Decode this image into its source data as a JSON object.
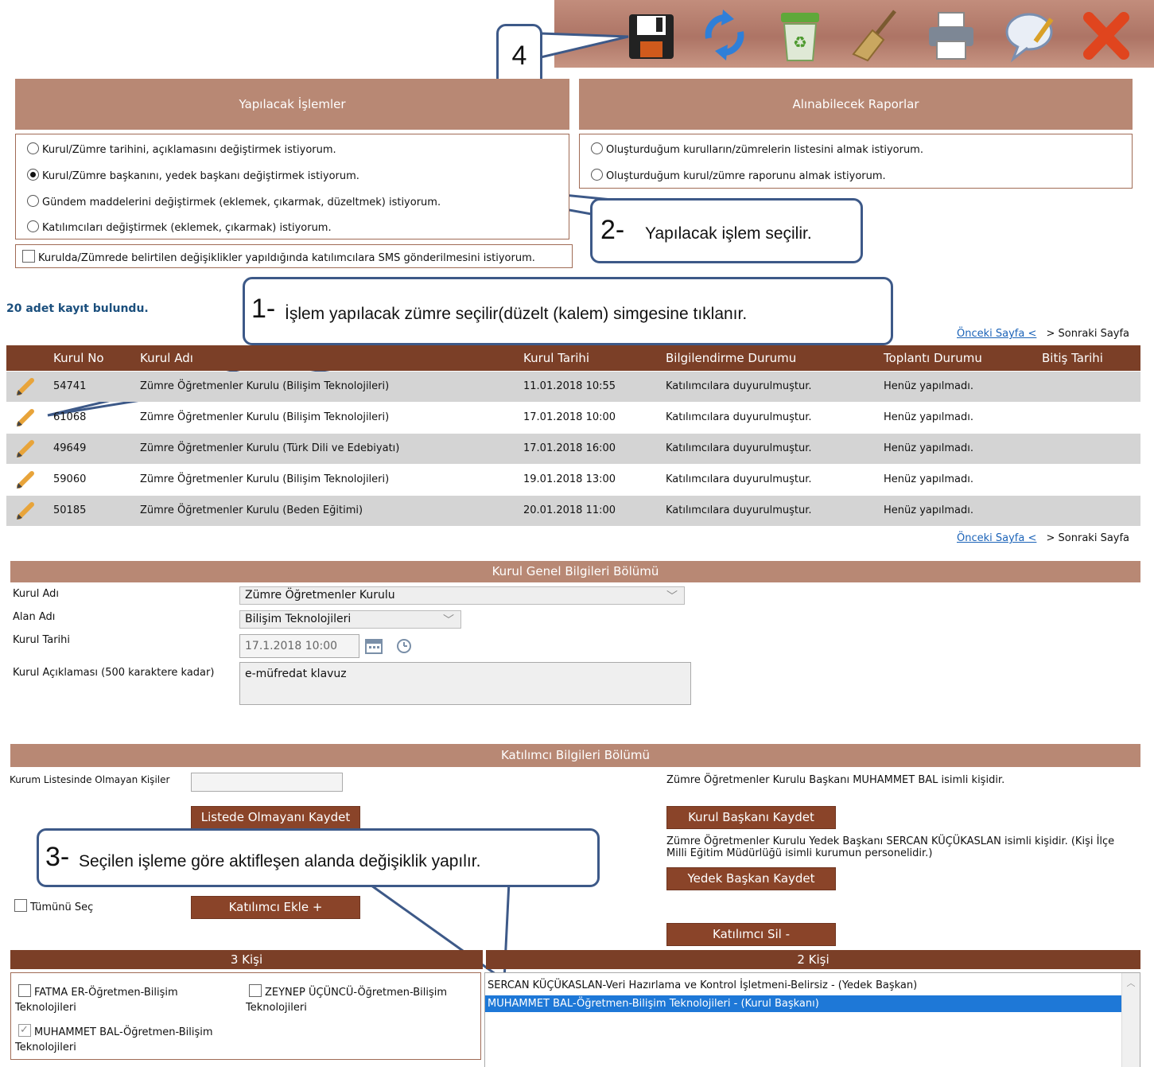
{
  "toolbar": {
    "icons": [
      "save-icon",
      "refresh-icon",
      "recycle-bin-icon",
      "broom-icon",
      "printer-icon",
      "speech-bubble-icon",
      "close-icon"
    ]
  },
  "callouts": {
    "c4": "4",
    "c2_num": "2-",
    "c2_text": "Yapılacak işlem seçilir.",
    "c1_num": "1-",
    "c1_text": "İşlem yapılacak zümre seçilir(düzelt (kalem) simgesine tıklanır.",
    "c3_num": "3-",
    "c3_text": "Seçilen işleme göre aktifleşen alanda değişiklik yapılır."
  },
  "operations": {
    "title": "Yapılacak İşlemler",
    "options": [
      "Kurul/Zümre tarihini, açıklamasını değiştirmek istiyorum.",
      "Kurul/Zümre başkanını, yedek başkanı değiştirmek istiyorum.",
      "Gündem maddelerini değiştirmek (eklemek, çıkarmak, düzeltmek) istiyorum.",
      "Katılımcıları değiştirmek (eklemek, çıkarmak) istiyorum."
    ],
    "selected_index": 1,
    "sms_label": "Kurulda/Zümrede belirtilen değişiklikler yapıldığında katılımcılara SMS gönderilmesini istiyorum."
  },
  "reports": {
    "title": "Alınabilecek Raporlar",
    "options": [
      "Oluşturduğum kurulların/zümrelerin listesini almak istiyorum.",
      "Oluşturduğum kurul/zümre raporunu almak istiyorum."
    ]
  },
  "records": {
    "count_text": "20 adet kayıt bulundu.",
    "prev_page": "Önceki Sayfa <",
    "next_page": "> Sonraki Sayfa",
    "columns": [
      "Kurul No",
      "Kurul Adı",
      "Kurul Tarihi",
      "Bilgilendirme Durumu",
      "Toplantı Durumu",
      "Bitiş Tarihi"
    ],
    "rows": [
      {
        "no": "54741",
        "name": "Zümre Öğretmenler Kurulu (Bilişim Teknolojileri)",
        "date": "11.01.2018 10:55",
        "info": "Katılımcılara duyurulmuştur.",
        "meeting": "Henüz yapılmadı.",
        "end": ""
      },
      {
        "no": "61068",
        "name": "Zümre Öğretmenler Kurulu (Bilişim Teknolojileri)",
        "date": "17.01.2018 10:00",
        "info": "Katılımcılara duyurulmuştur.",
        "meeting": "Henüz yapılmadı.",
        "end": ""
      },
      {
        "no": "49649",
        "name": "Zümre Öğretmenler Kurulu (Türk Dili ve Edebiyatı)",
        "date": "17.01.2018 16:00",
        "info": "Katılımcılara duyurulmuştur.",
        "meeting": "Henüz yapılmadı.",
        "end": ""
      },
      {
        "no": "59060",
        "name": "Zümre Öğretmenler Kurulu (Bilişim Teknolojileri)",
        "date": "19.01.2018 13:00",
        "info": "Katılımcılara duyurulmuştur.",
        "meeting": "Henüz yapılmadı.",
        "end": ""
      },
      {
        "no": "50185",
        "name": "Zümre Öğretmenler Kurulu (Beden Eğitimi)",
        "date": "20.01.2018 11:00",
        "info": "Katılımcılara duyurulmuştur.",
        "meeting": "Henüz yapılmadı.",
        "end": ""
      }
    ]
  },
  "general": {
    "title": "Kurul Genel Bilgileri Bölümü",
    "kurul_adi_label": "Kurul Adı",
    "kurul_adi_value": "Zümre Öğretmenler Kurulu",
    "alan_adi_label": "Alan Adı",
    "alan_adi_value": "Bilişim Teknolojileri",
    "tarih_label": "Kurul Tarihi",
    "tarih_value": "17.1.2018 10:00",
    "aciklama_label": "Kurul Açıklaması (500 karaktere kadar)",
    "aciklama_value": "e-müfredat klavuz"
  },
  "participants": {
    "title": "Katılımcı Bilgileri Bölümü",
    "not_in_list_label": "Kurum Listesinde Olmayan Kişiler",
    "not_in_list_value": "",
    "save_not_in_list": "Listede Olmayanı Kaydet",
    "select_all": "Tümünü Seç",
    "add_participant": "Katılımcı Ekle +",
    "president_text": "Zümre Öğretmenler Kurulu Başkanı MUHAMMET BAL isimli kişidir.",
    "save_president": "Kurul Başkanı Kaydet",
    "vice_text": "Zümre Öğretmenler Kurulu Yedek Başkanı SERCAN KÜÇÜKASLAN isimli kişidir. (Kişi İlçe Milli Eğitim Müdürlüğü isimli kurumun personelidir.)",
    "save_vice": "Yedek Başkan Kaydet",
    "remove_participant": "Katılımcı Sil -",
    "left_count": "3 Kişi",
    "right_count": "2 Kişi",
    "left_people": [
      {
        "label": "FATMA ER-Öğretmen-Bilişim Teknolojileri",
        "checked": false
      },
      {
        "label": "ZEYNEP ÜÇÜNCÜ-Öğretmen-Bilişim Teknolojileri",
        "checked": false
      },
      {
        "label": "MUHAMMET BAL-Öğretmen-Bilişim Teknolojileri",
        "checked": true
      }
    ],
    "right_people": [
      "SERCAN KÜÇÜKASLAN-Veri Hazırlama ve Kontrol İşletmeni-Belirsiz - (Yedek Başkan)",
      "MUHAMMET BAL-Öğretmen-Bilişim Teknolojileri - (Kurul Başkanı)"
    ],
    "right_selected_index": 1
  },
  "colors": {
    "brown_header": "#b88874",
    "dark_brown": "#7b3f27",
    "link": "#1b63b8",
    "selection": "#1e78d7",
    "callout_border": "#3d5988"
  }
}
